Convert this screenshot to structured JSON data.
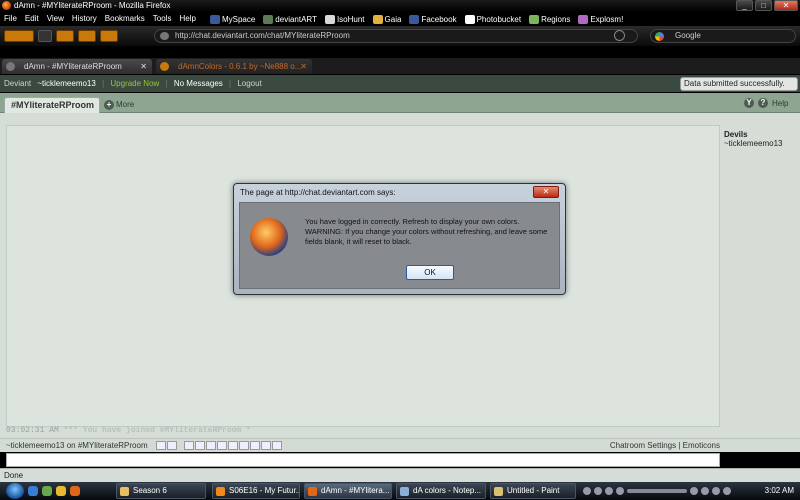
{
  "window": {
    "title": "dAmn - #MYliterateRProom - Mozilla Firefox",
    "minimize": "_",
    "maximize": "□",
    "close": "✕"
  },
  "menubar": {
    "items": [
      "File",
      "Edit",
      "View",
      "History",
      "Bookmarks",
      "Tools",
      "Help"
    ],
    "bookmarks": [
      {
        "label": "MySpace",
        "color": "#3a5a9c"
      },
      {
        "label": "deviantART",
        "color": "#5c7a56"
      },
      {
        "label": "IsoHunt",
        "color": "#d8d8d8"
      },
      {
        "label": "Gaia",
        "color": "#e3b13d"
      },
      {
        "label": "Facebook",
        "color": "#3b5998"
      },
      {
        "label": "Photobucket",
        "color": "#ffffff"
      },
      {
        "label": "Regions",
        "color": "#7ab55c"
      },
      {
        "label": "Explosm!",
        "color": "#b06ac0"
      }
    ]
  },
  "nav": {
    "url": "http://chat.deviantart.com/chat/MYliterateRProom",
    "search_placeholder": "Google"
  },
  "tabs": [
    {
      "label": "dAmn - #MYliterateRProom",
      "close": "✕"
    },
    {
      "label": "dAmnColors - 0.6.1 by ~Ne888 o...",
      "close": "✕"
    }
  ],
  "deviantbar": {
    "deviant": "Deviant",
    "user": "~ticklemeemo13",
    "upgrade": "Upgrade Now",
    "messages": "No Messages",
    "logout": "Logout"
  },
  "notification": "Data submitted successfully.",
  "room": {
    "tab": "#MYliterateRProom",
    "more": "More",
    "more_icon": "+",
    "help": "Help",
    "help_icon": "?",
    "y_icon": "Y"
  },
  "members": {
    "title": "Devils",
    "items": [
      "~ticklemeemo13"
    ]
  },
  "chat": {
    "timestamp": "03:02:31 AM",
    "message": "*** You have joined #MYliterateRProom *"
  },
  "input": {
    "label": "~ticklemeemo13 on #MYliterateRProom",
    "settings": "Chatroom Settings | Emoticons"
  },
  "status": "Done",
  "dialog": {
    "title": "The page at http://chat.deviantart.com says:",
    "close": "✕",
    "line1": "You have logged in correctly. Refresh to display your own colors.",
    "line2": "WARNING: If you change your colors without refreshing, and leave some fields blank, it will reset to black.",
    "ok": "OK"
  },
  "taskbar": {
    "items": [
      {
        "label": "Season 6",
        "color": "#e8c060"
      },
      {
        "label": "S06E16 - My Futur...",
        "color": "#f08a1c"
      },
      {
        "label": "dAmn - #MYlitera...",
        "color": "#e0661a"
      },
      {
        "label": "dA colors - Notep...",
        "color": "#8ab0d8"
      },
      {
        "label": "Untitled - Paint",
        "color": "#d8c070"
      }
    ],
    "clock": "3:02 AM"
  }
}
